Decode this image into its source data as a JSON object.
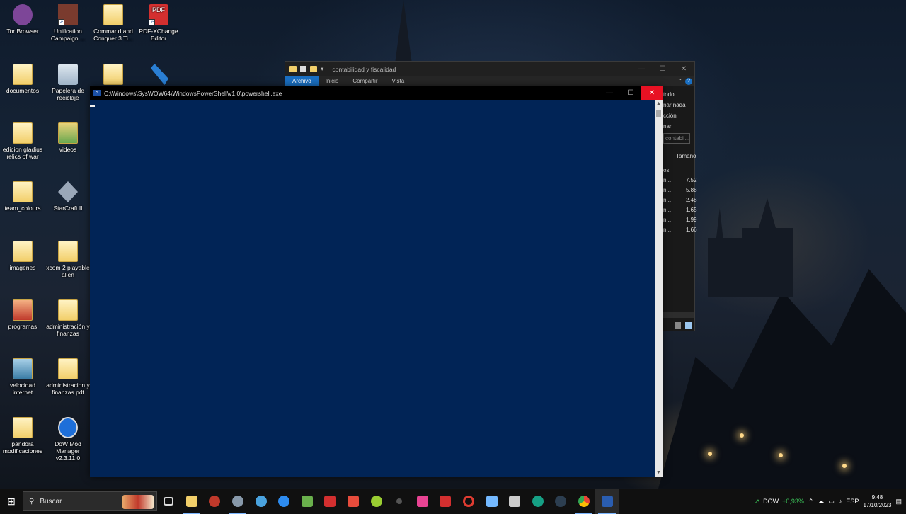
{
  "desktop_icons": [
    {
      "label": "Tor Browser",
      "icon": "tor-icon",
      "color": "#7d4698"
    },
    {
      "label": "Unification Campaign ...",
      "icon": "game-icon",
      "color": "#7a3b2e"
    },
    {
      "label": "Command and Conquer 3 Ti...",
      "icon": "folder-icon",
      "color": "#f2cf6a"
    },
    {
      "label": "PDF-XChange Editor",
      "icon": "pdf-icon",
      "color": "#d32f2f",
      "badge": "PDF"
    },
    {
      "label": "documentos",
      "icon": "folder-icon",
      "color": "#f2cf6a"
    },
    {
      "label": "Papelera de reciclaje",
      "icon": "recycle-bin-icon",
      "color": "#9fb4c8"
    },
    {
      "label": "",
      "icon": "folder-icon",
      "color": "#f2cf6a"
    },
    {
      "label": "",
      "icon": "tool-icon",
      "color": "#2a7fd4"
    },
    {
      "label": "edicion gladius relics of war",
      "icon": "folder-icon",
      "color": "#f2cf6a"
    },
    {
      "label": "videos",
      "icon": "folder-icon",
      "color": "#6aa84f"
    },
    {
      "label": "team_colours",
      "icon": "folder-icon",
      "color": "#f2cf6a"
    },
    {
      "label": "StarCraft II",
      "icon": "starcraft-icon",
      "color": "#9aa7b8"
    },
    {
      "label": "imagenes",
      "icon": "folder-icon",
      "color": "#f2cf6a"
    },
    {
      "label": "xcom 2 playable alien",
      "icon": "folder-icon",
      "color": "#f2cf6a"
    },
    {
      "label": "programas",
      "icon": "folder-icon",
      "color": "#c0392b"
    },
    {
      "label": "administración y finanzas",
      "icon": "folder-icon",
      "color": "#f2cf6a"
    },
    {
      "label": "velocidad internet",
      "icon": "folder-icon",
      "color": "#3a7ca5"
    },
    {
      "label": "administracion y finanzas pdf",
      "icon": "folder-icon",
      "color": "#f2cf6a"
    },
    {
      "label": "pandora modificaciones",
      "icon": "folder-icon",
      "color": "#f2cf6a"
    },
    {
      "label": "DoW Mod Manager v2.3.11.0",
      "icon": "wrench-icon",
      "color": "#1e6fd9"
    }
  ],
  "explorer": {
    "title": "contabilidad y fiscalidad",
    "ribbon_tabs": [
      "Archivo",
      "Inicio",
      "Compartir",
      "Vista"
    ],
    "right_fragments": [
      "todo",
      "nar nada",
      "cción",
      "nar"
    ],
    "search_placeholder": "contabil...",
    "column_header": "Tamaño",
    "partial_left": "os",
    "sizes": [
      "7.52",
      "5.88",
      "2.48",
      "1.65",
      "1.99",
      "1.66"
    ],
    "row_prefix": "n..."
  },
  "powershell": {
    "title": "C:\\Windows\\SysWOW64\\WindowsPowerShell\\v1.0\\powershell.exe",
    "bg_color": "#012456"
  },
  "taskbar": {
    "search_placeholder": "Buscar",
    "apps": [
      {
        "icon": "task-view-icon",
        "color": "#dddddd"
      },
      {
        "icon": "file-explorer-icon",
        "color": "#f2cf6a"
      },
      {
        "icon": "app-red-icon",
        "color": "#c0392b"
      },
      {
        "icon": "app-grey-icon",
        "color": "#8899aa"
      },
      {
        "icon": "search-tool-icon",
        "color": "#4aa3df"
      },
      {
        "icon": "lightning-icon",
        "color": "#2d8cf0"
      },
      {
        "icon": "app-green-icon",
        "color": "#6ab04c"
      },
      {
        "icon": "acrobat-icon",
        "color": "#d32f2f"
      },
      {
        "icon": "app-s-icon",
        "color": "#e74c3c"
      },
      {
        "icon": "app-lime-icon",
        "color": "#9acd32"
      },
      {
        "icon": "app-dot-icon",
        "color": "#555555"
      },
      {
        "icon": "app-s2-icon",
        "color": "#e84393"
      },
      {
        "icon": "acrobat2-icon",
        "color": "#d32f2f"
      },
      {
        "icon": "opera-icon",
        "color": "#e03c31"
      },
      {
        "icon": "app-teal-icon",
        "color": "#74b9ff"
      },
      {
        "icon": "clapper-icon",
        "color": "#cccccc"
      },
      {
        "icon": "app-cyan-icon",
        "color": "#16a085"
      },
      {
        "icon": "app-blue-icon",
        "color": "#2c3e50"
      },
      {
        "icon": "chrome-icon",
        "color": "#34a853"
      },
      {
        "icon": "powershell-icon",
        "color": "#2a5db0"
      }
    ],
    "stock_name": "DOW",
    "stock_change": "+0,93%",
    "language": "ESP",
    "time": "9:48",
    "date": "17/10/2023"
  }
}
